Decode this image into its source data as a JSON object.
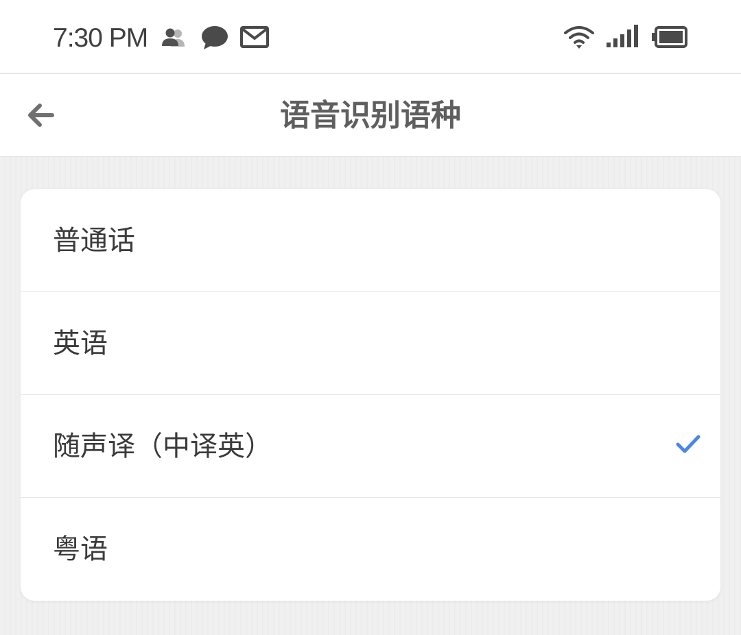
{
  "status_bar": {
    "time": "7:30 PM",
    "icons": [
      "contacts-icon",
      "chat-bubble-icon",
      "mail-icon",
      "wifi-icon",
      "cell-signal-icon",
      "battery-icon"
    ]
  },
  "header": {
    "back_icon": "arrow-left-icon",
    "title": "语音识别语种"
  },
  "language_options": [
    {
      "label": "普通话",
      "selected": false
    },
    {
      "label": "英语",
      "selected": false
    },
    {
      "label": "随声译（中译英）",
      "selected": true
    },
    {
      "label": "粤语",
      "selected": false
    }
  ],
  "colors": {
    "accent_check": "#4a86e8",
    "title_text": "#5f5f5f",
    "background": "#efefef"
  }
}
